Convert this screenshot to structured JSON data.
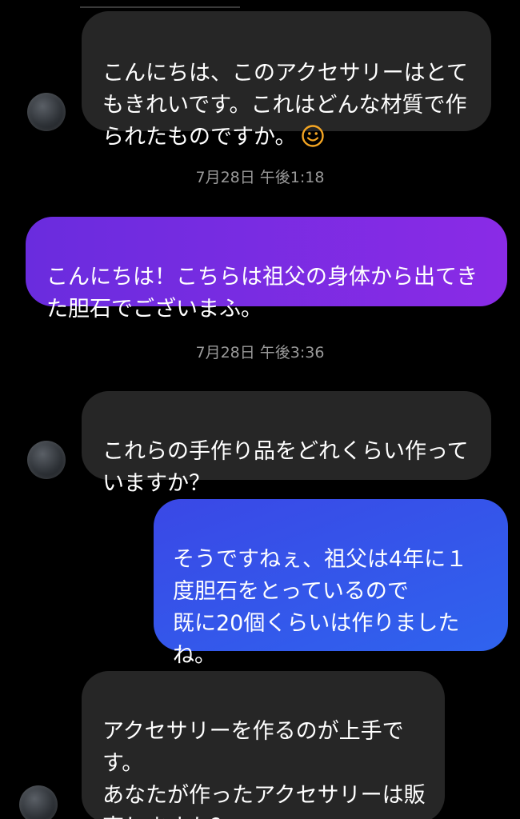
{
  "conversation": {
    "messages": [
      {
        "sender": "other",
        "text": "こんにちは、このアクセサリーはとてもきれいです。これはどんな材質で作られたものですか。",
        "emoji": "smile-emoji"
      },
      {
        "type": "timestamp",
        "text": "7月28日 午後1:18"
      },
      {
        "sender": "me",
        "text": "こんにちは！こちらは祖父の身体から出てきた胆石でございまふ。"
      },
      {
        "type": "timestamp",
        "text": "7月28日 午後3:36"
      },
      {
        "sender": "other",
        "text": "これらの手作り品をどれくらい作っていますか？"
      },
      {
        "sender": "me",
        "text": "そうですねぇ、祖父は4年に１度胆石をとっているので\n既に20個くらいは作りましたね。"
      },
      {
        "sender": "other",
        "text": "アクセサリーを作るのが上手です。\nあなたが作ったアクセサリーは販売しますか？"
      }
    ]
  },
  "colors": {
    "incoming_bubble": "#262626",
    "outgoing_purple": "#7b2be2",
    "outgoing_blue": "#3558ea",
    "timestamp": "#9a9a9a",
    "emoji": "#f5a623"
  }
}
